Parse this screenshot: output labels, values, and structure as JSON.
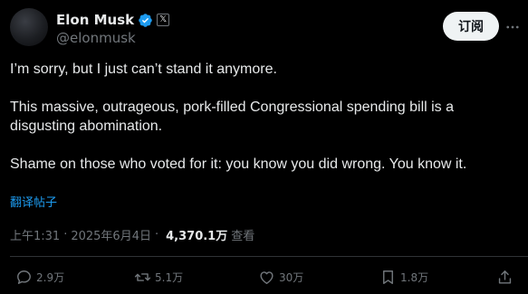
{
  "author": {
    "display_name": "Elon Musk",
    "handle": "@elonmusk",
    "verified_color": "#1d9bf0",
    "affiliation_badge": "𝕏"
  },
  "header": {
    "subscribe_label": "订阅",
    "more_icon": "more-icon"
  },
  "post": {
    "paragraphs": [
      "I’m sorry, but I just can’t stand it anymore.",
      "This massive, outrageous, pork-filled Congressional spending bill is a disgusting abomination.",
      "Shame on those who voted for it: you know you did wrong. You know it."
    ],
    "translate_label": "翻译帖子"
  },
  "meta": {
    "time": "上午1:31",
    "date": "2025年6月4日",
    "separator": "·",
    "views_count": "4,370.1万",
    "views_label": "查看"
  },
  "actions": {
    "replies": "2.9万",
    "reposts": "5.1万",
    "likes": "30万",
    "bookmarks": "1.8万"
  }
}
